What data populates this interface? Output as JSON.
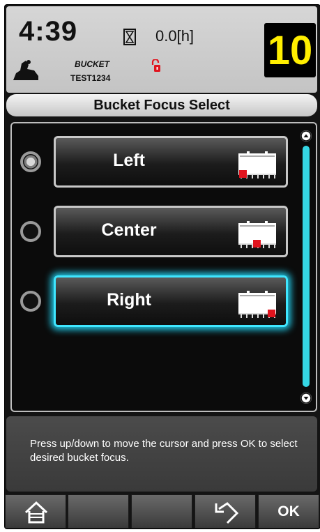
{
  "header": {
    "time": "4:39",
    "hours": "0.0[h]",
    "mode": "BUCKET",
    "machine": "TEST1234",
    "counter": "10"
  },
  "title": "Bucket Focus Select",
  "options": [
    {
      "label": "Left",
      "selected": true,
      "focused": false,
      "focus_position": "left"
    },
    {
      "label": "Center",
      "selected": false,
      "focused": false,
      "focus_position": "center"
    },
    {
      "label": "Right",
      "selected": false,
      "focused": true,
      "focus_position": "right"
    }
  ],
  "help": "Press up/down to move the cursor and press OK to select desired bucket focus.",
  "softkeys": {
    "home": "home-icon",
    "back": "back-arrow-icon",
    "ok": "OK"
  },
  "colors": {
    "counter_text": "#ffee00",
    "focus_glow": "#3fe6ff",
    "scrollbar": "#35d6e4",
    "lock": "#e0141e",
    "bucket_marker": "#e0141e"
  }
}
